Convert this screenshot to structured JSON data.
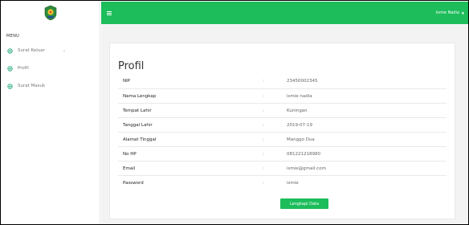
{
  "topbar": {
    "user_name": "Ismie Nadia"
  },
  "sidebar": {
    "menu_header": "MENU",
    "items": [
      {
        "label": "Surat Keluar",
        "icon": "globe-icon",
        "has_submenu": true
      },
      {
        "label": "Profil",
        "icon": "globe-icon",
        "has_submenu": false
      },
      {
        "label": "Surat Masuk",
        "icon": "globe-icon",
        "has_submenu": false
      }
    ]
  },
  "main": {
    "title": "Profil",
    "separator": ":",
    "fields": [
      {
        "label": "NIP",
        "value": "23450002345"
      },
      {
        "label": "Nama Lengkap",
        "value": "ismie nadia"
      },
      {
        "label": "Tempat Lahir",
        "value": "Kuningan"
      },
      {
        "label": "Tanggal Lahir",
        "value": "2019-07-19"
      },
      {
        "label": "Alamat Tinggal",
        "value": "Manggo Dua"
      },
      {
        "label": "No HP",
        "value": "081221218980"
      },
      {
        "label": "Email",
        "value": "ismie@gmail.com"
      },
      {
        "label": "Password",
        "value": "ismie"
      }
    ],
    "button_label": "Lengkapi Data"
  },
  "colors": {
    "accent": "#1cbd5a",
    "icon": "#18a672"
  }
}
